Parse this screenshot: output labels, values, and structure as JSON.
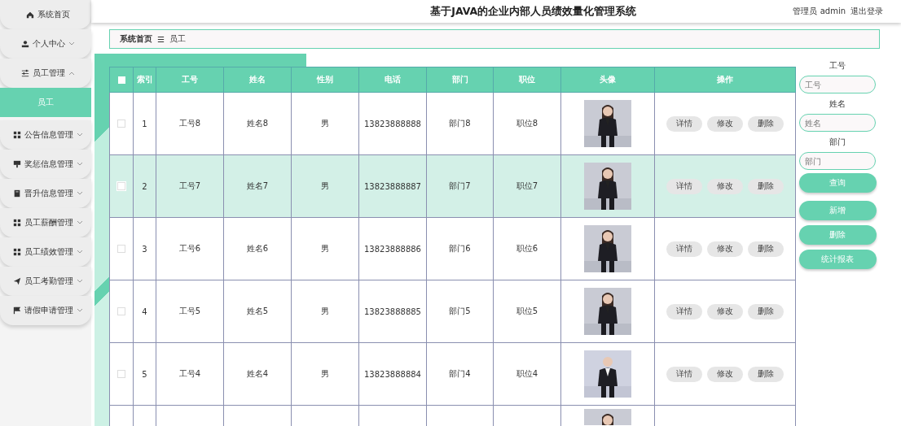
{
  "header": {
    "title": "基于JAVA的企业内部人员绩效量化管理系统",
    "user": "管理员 admin",
    "logout": "退出登录"
  },
  "sidebar": {
    "items": [
      {
        "label": "系统首页",
        "kind": "plain",
        "selected": false
      },
      {
        "label": "个人中心",
        "kind": "menu",
        "expanded": false,
        "selected": false
      },
      {
        "label": "员工管理",
        "kind": "menu",
        "expanded": true,
        "selected": false,
        "children": [
          {
            "label": "员工",
            "selected": true
          }
        ]
      },
      {
        "label": "公告信息管理",
        "kind": "menu",
        "expanded": false,
        "selected": false
      },
      {
        "label": "奖惩信息管理",
        "kind": "menu",
        "expanded": false,
        "selected": false
      },
      {
        "label": "晋升信息管理",
        "kind": "menu",
        "expanded": false,
        "selected": false
      },
      {
        "label": "员工薪酬管理",
        "kind": "menu",
        "expanded": false,
        "selected": false
      },
      {
        "label": "员工绩效管理",
        "kind": "menu",
        "expanded": false,
        "selected": false
      },
      {
        "label": "员工考勤管理",
        "kind": "menu",
        "expanded": false,
        "selected": false
      },
      {
        "label": "请假申请管理",
        "kind": "menu",
        "expanded": false,
        "selected": false
      }
    ]
  },
  "breadcrumb": {
    "items": [
      "系统首页",
      "员工"
    ],
    "separator": "☰"
  },
  "table": {
    "all_checked": false,
    "columns": [
      "索引",
      "工号",
      "姓名",
      "性别",
      "电话",
      "部门",
      "职位",
      "头像",
      "操作"
    ],
    "rows": [
      {
        "kind": "full",
        "selected": false,
        "cells": [
          "1",
          "工号8",
          "姓名8",
          "男",
          "13823888888",
          "部门8",
          "职位8"
        ],
        "actions": [
          "详情",
          "修改",
          "删除"
        ]
      },
      {
        "kind": "full",
        "selected": true,
        "cells": [
          "2",
          "工号7",
          "姓名7",
          "男",
          "13823888887",
          "部门7",
          "职位7"
        ],
        "actions": [
          "详情",
          "修改",
          "删除"
        ]
      },
      {
        "kind": "full",
        "selected": false,
        "cells": [
          "3",
          "工号6",
          "姓名6",
          "男",
          "13823888886",
          "部门6",
          "职位6"
        ],
        "actions": [
          "详情",
          "修改",
          "删除"
        ]
      },
      {
        "kind": "full",
        "selected": false,
        "cells": [
          "4",
          "工号5",
          "姓名5",
          "男",
          "13823888885",
          "部门5",
          "职位5"
        ],
        "actions": [
          "详情",
          "修改",
          "删除"
        ]
      },
      {
        "kind": "full",
        "selected": false,
        "cells": [
          "5",
          "工号4",
          "姓名4",
          "男",
          "13823888884",
          "部门4",
          "职位4"
        ],
        "actions": [
          "详情",
          "修改",
          "删除"
        ]
      },
      {
        "kind": "cut"
      }
    ]
  },
  "search": {
    "fields": [
      {
        "label": "工号",
        "placeholder": "工号"
      },
      {
        "label": "姓名",
        "placeholder": "姓名"
      },
      {
        "label": "部门",
        "placeholder": "部门"
      }
    ],
    "buttons": [
      "查询",
      "新增",
      "删除",
      "统计报表"
    ]
  }
}
